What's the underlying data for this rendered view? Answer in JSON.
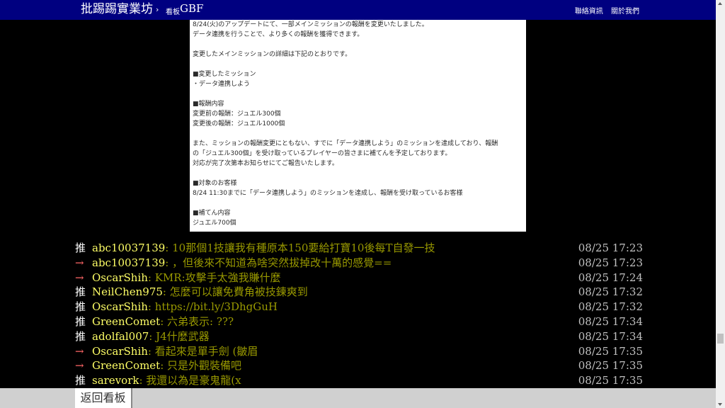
{
  "header": {
    "site_title": "批踢踢實業坊",
    "separator": "›",
    "board_label": "看板",
    "board_name": "GBF",
    "links": [
      "聯絡資訊",
      "關於我們"
    ]
  },
  "article_image": {
    "lines": [
      "8/24(火)のアップデートにて、一部メインミッションの報酬を変更いたしました。",
      "データ連携を行うことで、より多くの報酬を獲得できます。",
      "",
      "変更したメインミッションの詳細は下記のとおりです。",
      "",
      "■変更したミッション",
      "・データ連携しよう",
      "",
      "■報酬内容",
      "変更前の報酬：ジュエル300個",
      "変更後の報酬：ジュエル1000個",
      "",
      "また、ミッションの報酬変更にともない、すでに「データ連携しよう」のミッションを達成しており、報酬",
      "の「ジュエル300個」を受け取っているプレイヤーの皆さまに補てんを予定しております。",
      "対応が完了次第本お知らせにてご報告いたします。",
      "",
      "■対象のお客様",
      "8/24 11:30までに「データ連携しよう」のミッションを達成し、報酬を受け取っているお客様",
      "",
      "■補てん内容",
      "ジュエル700個"
    ]
  },
  "comments": [
    {
      "tag": "推",
      "type": "up",
      "user": "abc10037139",
      "content": ": 10那個1技讓我有種原本150要給打寶10後每T自發一技",
      "time": "08/25 17:23"
    },
    {
      "tag": "→",
      "type": "arrow",
      "user": "abc10037139",
      "content": ": ，但後來不知道為啥突然拔掉改十萬的感覺==",
      "time": "08/25 17:23"
    },
    {
      "tag": "→",
      "type": "arrow",
      "user": "OscarShih",
      "content": ": KMR:攻擊手太強我賺什麼",
      "time": "08/25 17:24"
    },
    {
      "tag": "推",
      "type": "up",
      "user": "NeilChen975",
      "content": ": 怎麼可以讓免費角被技鍊爽到",
      "time": "08/25 17:32"
    },
    {
      "tag": "推",
      "type": "up",
      "user": "OscarShih",
      "content": ": ",
      "link": "https://bit.ly/3DhgGuH",
      "time": "08/25 17:32"
    },
    {
      "tag": "推",
      "type": "up",
      "user": "GreenComet",
      "content": ": 六弟表示: ???",
      "time": "08/25 17:34"
    },
    {
      "tag": "推",
      "type": "up",
      "user": "adolfal007",
      "content": ": J4什麼武器",
      "time": "08/25 17:34"
    },
    {
      "tag": "→",
      "type": "arrow",
      "user": "OscarShih",
      "content": ": 看起來是單手劍 (皺眉",
      "time": "08/25 17:35"
    },
    {
      "tag": "→",
      "type": "arrow",
      "user": "GreenComet",
      "content": ": 只是外觀裝備吧",
      "time": "08/25 17:35"
    },
    {
      "tag": "推",
      "type": "up",
      "user": "sarevork",
      "content": ": 我還以為是豪鬼龍(x",
      "time": "08/25 17:35"
    }
  ],
  "footer": {
    "back_label": "返回看板"
  },
  "colors": {
    "topbar": "#000080",
    "userid": "#ffff66",
    "content": "#999900",
    "arrow_tag": "#ff6666",
    "up_tag": "#ffffff"
  }
}
